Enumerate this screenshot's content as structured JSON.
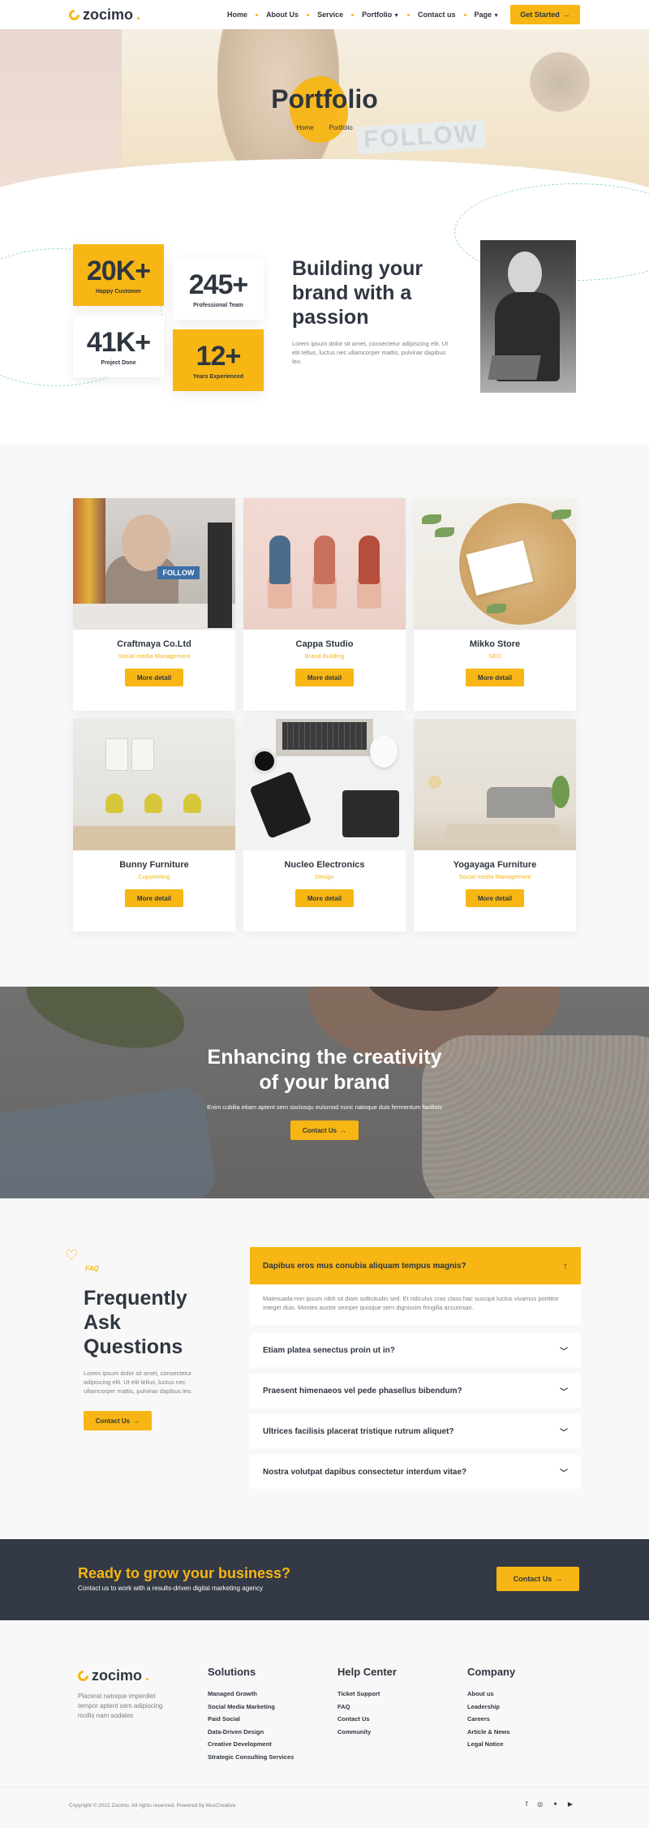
{
  "brand": {
    "name": "zocimo",
    "dot": "."
  },
  "nav": {
    "items": [
      "Home",
      "About Us",
      "Service",
      "Portfolio",
      "Contact us",
      "Page"
    ],
    "cta": "Get Started",
    "cta_arrow": "→"
  },
  "hero": {
    "title": "Portfolio",
    "breadcrumb_home": "Home",
    "breadcrumb_sep": ">",
    "breadcrumb_current": "Portfolio",
    "sign_text": "FOLLOW"
  },
  "stats": [
    {
      "value": "20K+",
      "label": "Happy Customer"
    },
    {
      "value": "245+",
      "label": "Professional Team"
    },
    {
      "value": "41K+",
      "label": "Project Done"
    },
    {
      "value": "12+",
      "label": "Years Experienced"
    }
  ],
  "about": {
    "heading": "Building your brand with a passion",
    "text": "Lorem ipsum dolor sit amet, consectetur adipiscing elit. Ut elit tellus, luctus nec ullamcorper mattis, pulvinar dapibus leo."
  },
  "portfolio": {
    "more_label": "More detail",
    "items": [
      {
        "title": "Craftmaya Co.Ltd",
        "category": "Social media Management"
      },
      {
        "title": "Cappa Studio",
        "category": "Brand Building"
      },
      {
        "title": "Mikko Store",
        "category": "SEO"
      },
      {
        "title": "Bunny Furniture",
        "category": "Copywriting"
      },
      {
        "title": "Nucleo Electronics",
        "category": "Design"
      },
      {
        "title": "Yogayaga Furniture",
        "category": "Social media Management"
      }
    ],
    "image_sign_text": "FOLLOW"
  },
  "banner": {
    "heading_line1": "Enhancing the creativity",
    "heading_line2": "of your brand",
    "text": "Enim cubilia etiam aptent sem sociosqu euismod nunc natoque duis fermentum facilisis",
    "cta": "Contact Us",
    "cta_arrow": "→"
  },
  "faq": {
    "tag": "FAQ",
    "heading": "Frequently Ask Questions",
    "lead": "Lorem ipsum dolor sit amet, consectetur adipiscing elit. Ut elit tellus, luctus nec ullamcorper mattis, pulvinar dapibus leo.",
    "cta": "Contact Us",
    "cta_arrow": "→",
    "open_question": "Dapibus eros mus conubia aliquam tempus magnis?",
    "open_answer": "Malesuada non ipsum nibh sit diam sollicitudin sed. Et ridiculus cras class hac suscipit luctus vivamus porttitor integer duis. Montes auctor semper quisque sem dignissim fringilla accumsan.",
    "questions": [
      "Etiam platea senectus proin ut in?",
      "Praesent himenaeos vel pede phasellus bibendum?",
      "Ultrices facilisis placerat tristique rutrum aliquet?",
      "Nostra volutpat dapibus consectetur interdum vitae?"
    ]
  },
  "cta_band": {
    "heading": "Ready to grow your business?",
    "text": "Contact us to work with a results-driven digital marketing agency",
    "button": "Contact Us",
    "button_arrow": "→"
  },
  "footer": {
    "about": "Placerat natoque imperdiet tempor aptent sem adipiscing mollis nam sodales",
    "columns": [
      {
        "title": "Solutions",
        "items": [
          "Managed Growth",
          "Social Media Marketing",
          "Paid Social",
          "Data-Driven Design",
          "Creative Development",
          "Strategic Consulting Services"
        ]
      },
      {
        "title": "Help Center",
        "items": [
          "Ticket Support",
          "FAQ",
          "Contact Us",
          "Community"
        ]
      },
      {
        "title": "Company",
        "items": [
          "About us",
          "Leadership",
          "Careers",
          "Article & News",
          "Legal Notice"
        ]
      }
    ],
    "copyright": "Copyright © 2022 Zocimo. All rights reserved. Powered by MoxCreative.",
    "socials": [
      "facebook-icon",
      "instagram-icon",
      "twitter-icon",
      "youtube-icon"
    ]
  },
  "colors": {
    "accent": "#f7b614",
    "dark": "#333a45",
    "text": "#2f3640",
    "muted": "#7a7f87",
    "bg_light": "#f8f8f8"
  }
}
